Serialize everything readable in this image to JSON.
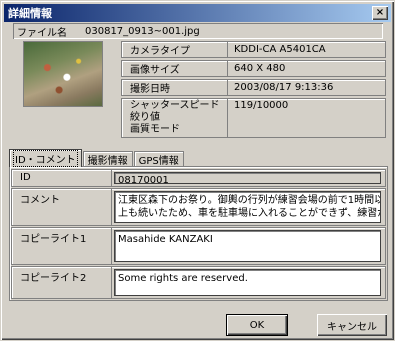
{
  "window": {
    "title": "詳細情報",
    "close_glyph": "×"
  },
  "file": {
    "label": "ファイル名",
    "value": "030817_0913~001.jpg"
  },
  "info": {
    "rows": [
      {
        "label": "カメラタイプ",
        "value": "KDDI-CA A5401CA"
      },
      {
        "label": "画像サイズ",
        "value": "640 X 480"
      },
      {
        "label": "撮影日時",
        "value": "2003/08/17 9:13:36"
      }
    ],
    "multi_labels": [
      "シャッタースピード",
      "絞り値",
      "画質モード"
    ],
    "multi_values": [
      "119/10000",
      "",
      ""
    ]
  },
  "tabs": [
    {
      "label": "ID・コメント",
      "active": true
    },
    {
      "label": "撮影情報",
      "active": false
    },
    {
      "label": "GPS情報",
      "active": false
    }
  ],
  "fields": {
    "id": {
      "label": "ID",
      "value": "08170001"
    },
    "comment": {
      "label": "コメント",
      "line1": "江東区森下のお祭り。御輿の行列が練習会場の前で1時間以",
      "line2": "上も続いたため、車を駐車場に入れることができず、練習が"
    },
    "copyright1": {
      "label": "コピーライト1",
      "value": "Masahide KANZAKI"
    },
    "copyright2": {
      "label": "コピーライト2",
      "value": "Some rights are reserved."
    }
  },
  "buttons": {
    "ok": "OK",
    "cancel": "キャンセル"
  }
}
